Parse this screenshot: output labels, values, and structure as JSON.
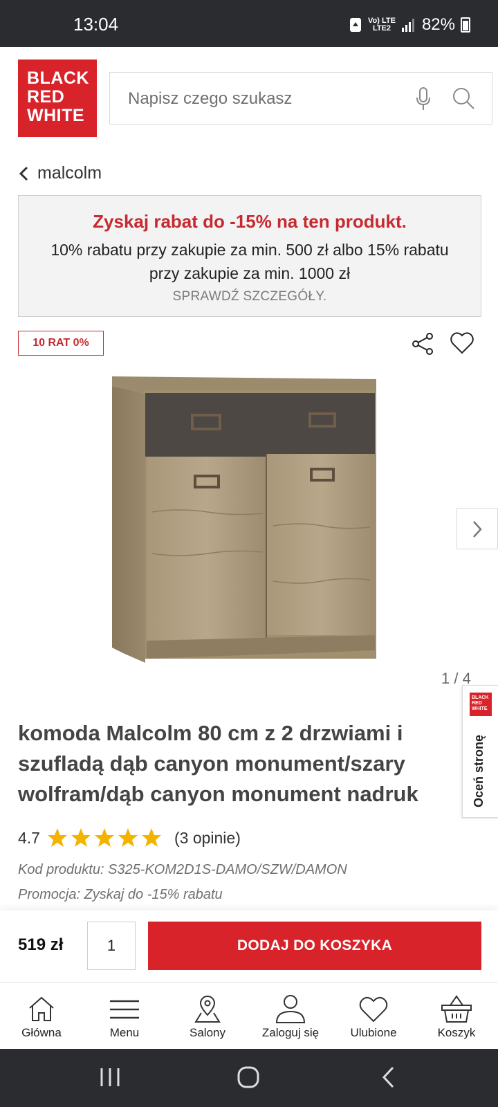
{
  "status_bar": {
    "time": "13:04",
    "network_top": "Vo) LTE",
    "network_bottom": "LTE2",
    "battery": "82%"
  },
  "header": {
    "logo_lines": [
      "BLACK",
      "RED",
      "WHITE"
    ],
    "search_placeholder": "Napisz czego szukasz"
  },
  "breadcrumb": {
    "label": "malcolm"
  },
  "promo": {
    "title": "Zyskaj rabat do -15% na ten produkt.",
    "description": "10% rabatu przy zakupie za min. 500 zł albo 15% rabatu przy zakupie za min. 1000 zł",
    "link": "SPRAWDŹ SZCZEGÓŁY."
  },
  "badge": {
    "installments": "10 RAT 0%"
  },
  "gallery": {
    "counter": "1 / 4"
  },
  "feedback_tab": {
    "logo_lines": [
      "BLACK",
      "RED",
      "WHITE"
    ],
    "label": "Oceń stronę"
  },
  "product": {
    "title": "komoda Malcolm 80 cm z 2 drzwiami i szufladą dąb canyon monument/szary wolfram/dąb canyon monument nadruk",
    "rating": "4.7",
    "stars": 5,
    "reviews": "(3 opinie)",
    "code": "Kod produktu: S325-KOM2D1S-DAMO/SZW/DAMON",
    "promotion": "Promocja: Zyskaj do -15% rabatu"
  },
  "purchase": {
    "price": "519 zł",
    "quantity": "1",
    "add_to_cart": "DODAJ DO KOSZYKA"
  },
  "bottom_nav": {
    "items": [
      {
        "label": "Główna",
        "icon": "home-icon"
      },
      {
        "label": "Menu",
        "icon": "menu-icon"
      },
      {
        "label": "Salony",
        "icon": "location-pin-icon"
      },
      {
        "label": "Zaloguj się",
        "icon": "user-icon"
      },
      {
        "label": "Ulubione",
        "icon": "heart-icon"
      },
      {
        "label": "Koszyk",
        "icon": "basket-icon"
      }
    ]
  },
  "colors": {
    "brand_red": "#d8232a",
    "promo_red": "#c62a2f",
    "star_yellow": "#f5b301",
    "status_bar": "#2b2c30"
  }
}
